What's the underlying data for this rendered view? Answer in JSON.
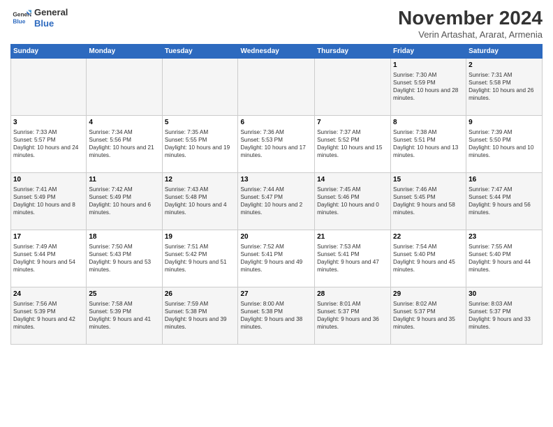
{
  "header": {
    "logo_line1": "General",
    "logo_line2": "Blue",
    "month": "November 2024",
    "location": "Verin Artashat, Ararat, Armenia"
  },
  "weekdays": [
    "Sunday",
    "Monday",
    "Tuesday",
    "Wednesday",
    "Thursday",
    "Friday",
    "Saturday"
  ],
  "weeks": [
    [
      {
        "day": "",
        "info": ""
      },
      {
        "day": "",
        "info": ""
      },
      {
        "day": "",
        "info": ""
      },
      {
        "day": "",
        "info": ""
      },
      {
        "day": "",
        "info": ""
      },
      {
        "day": "1",
        "info": "Sunrise: 7:30 AM\nSunset: 5:59 PM\nDaylight: 10 hours and 28 minutes."
      },
      {
        "day": "2",
        "info": "Sunrise: 7:31 AM\nSunset: 5:58 PM\nDaylight: 10 hours and 26 minutes."
      }
    ],
    [
      {
        "day": "3",
        "info": "Sunrise: 7:33 AM\nSunset: 5:57 PM\nDaylight: 10 hours and 24 minutes."
      },
      {
        "day": "4",
        "info": "Sunrise: 7:34 AM\nSunset: 5:56 PM\nDaylight: 10 hours and 21 minutes."
      },
      {
        "day": "5",
        "info": "Sunrise: 7:35 AM\nSunset: 5:55 PM\nDaylight: 10 hours and 19 minutes."
      },
      {
        "day": "6",
        "info": "Sunrise: 7:36 AM\nSunset: 5:53 PM\nDaylight: 10 hours and 17 minutes."
      },
      {
        "day": "7",
        "info": "Sunrise: 7:37 AM\nSunset: 5:52 PM\nDaylight: 10 hours and 15 minutes."
      },
      {
        "day": "8",
        "info": "Sunrise: 7:38 AM\nSunset: 5:51 PM\nDaylight: 10 hours and 13 minutes."
      },
      {
        "day": "9",
        "info": "Sunrise: 7:39 AM\nSunset: 5:50 PM\nDaylight: 10 hours and 10 minutes."
      }
    ],
    [
      {
        "day": "10",
        "info": "Sunrise: 7:41 AM\nSunset: 5:49 PM\nDaylight: 10 hours and 8 minutes."
      },
      {
        "day": "11",
        "info": "Sunrise: 7:42 AM\nSunset: 5:49 PM\nDaylight: 10 hours and 6 minutes."
      },
      {
        "day": "12",
        "info": "Sunrise: 7:43 AM\nSunset: 5:48 PM\nDaylight: 10 hours and 4 minutes."
      },
      {
        "day": "13",
        "info": "Sunrise: 7:44 AM\nSunset: 5:47 PM\nDaylight: 10 hours and 2 minutes."
      },
      {
        "day": "14",
        "info": "Sunrise: 7:45 AM\nSunset: 5:46 PM\nDaylight: 10 hours and 0 minutes."
      },
      {
        "day": "15",
        "info": "Sunrise: 7:46 AM\nSunset: 5:45 PM\nDaylight: 9 hours and 58 minutes."
      },
      {
        "day": "16",
        "info": "Sunrise: 7:47 AM\nSunset: 5:44 PM\nDaylight: 9 hours and 56 minutes."
      }
    ],
    [
      {
        "day": "17",
        "info": "Sunrise: 7:49 AM\nSunset: 5:44 PM\nDaylight: 9 hours and 54 minutes."
      },
      {
        "day": "18",
        "info": "Sunrise: 7:50 AM\nSunset: 5:43 PM\nDaylight: 9 hours and 53 minutes."
      },
      {
        "day": "19",
        "info": "Sunrise: 7:51 AM\nSunset: 5:42 PM\nDaylight: 9 hours and 51 minutes."
      },
      {
        "day": "20",
        "info": "Sunrise: 7:52 AM\nSunset: 5:41 PM\nDaylight: 9 hours and 49 minutes."
      },
      {
        "day": "21",
        "info": "Sunrise: 7:53 AM\nSunset: 5:41 PM\nDaylight: 9 hours and 47 minutes."
      },
      {
        "day": "22",
        "info": "Sunrise: 7:54 AM\nSunset: 5:40 PM\nDaylight: 9 hours and 45 minutes."
      },
      {
        "day": "23",
        "info": "Sunrise: 7:55 AM\nSunset: 5:40 PM\nDaylight: 9 hours and 44 minutes."
      }
    ],
    [
      {
        "day": "24",
        "info": "Sunrise: 7:56 AM\nSunset: 5:39 PM\nDaylight: 9 hours and 42 minutes."
      },
      {
        "day": "25",
        "info": "Sunrise: 7:58 AM\nSunset: 5:39 PM\nDaylight: 9 hours and 41 minutes."
      },
      {
        "day": "26",
        "info": "Sunrise: 7:59 AM\nSunset: 5:38 PM\nDaylight: 9 hours and 39 minutes."
      },
      {
        "day": "27",
        "info": "Sunrise: 8:00 AM\nSunset: 5:38 PM\nDaylight: 9 hours and 38 minutes."
      },
      {
        "day": "28",
        "info": "Sunrise: 8:01 AM\nSunset: 5:37 PM\nDaylight: 9 hours and 36 minutes."
      },
      {
        "day": "29",
        "info": "Sunrise: 8:02 AM\nSunset: 5:37 PM\nDaylight: 9 hours and 35 minutes."
      },
      {
        "day": "30",
        "info": "Sunrise: 8:03 AM\nSunset: 5:37 PM\nDaylight: 9 hours and 33 minutes."
      }
    ]
  ]
}
